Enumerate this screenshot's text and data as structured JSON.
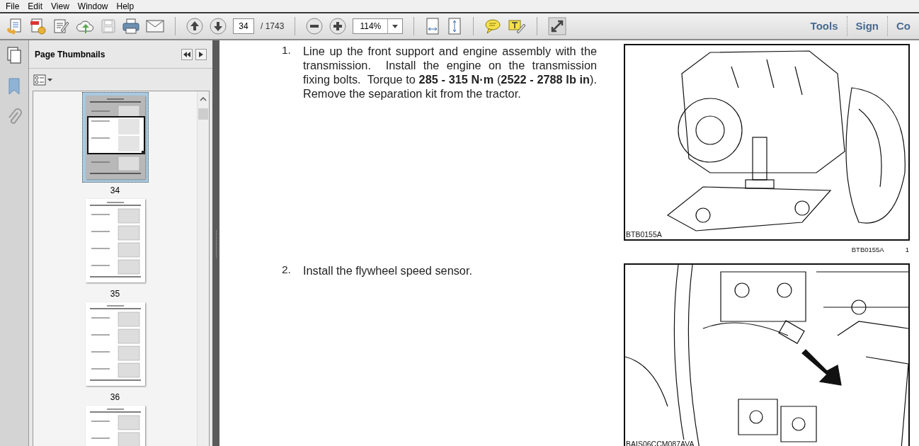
{
  "menu": [
    "File",
    "Edit",
    "View",
    "Window",
    "Help"
  ],
  "toolbar": {
    "page_number": "34",
    "page_count": "/ 1743",
    "zoom": "114%",
    "links": [
      "Tools",
      "Sign",
      "Co"
    ]
  },
  "side_panel": {
    "title": "Page Thumbnails",
    "thumbnails": [
      {
        "label": "34",
        "selected": true
      },
      {
        "label": "35",
        "selected": false
      },
      {
        "label": "36",
        "selected": false
      },
      {
        "selected": false
      }
    ]
  },
  "document": {
    "steps": [
      {
        "number": "1.",
        "text": "Line up the front support and engine assembly with the transmission.  Install the engine on the transmission fixing bolts.  Torque to **285 - 315 N·m** (**2522 - 2788 lb in**).  Remove the separation kit from the tractor.",
        "figure": {
          "kind": "engine",
          "label": "BTB0155A",
          "caption": "BTB0155A",
          "caption_number": "1"
        }
      },
      {
        "number": "2.",
        "text": "Install the flywheel speed sensor.",
        "figure": {
          "kind": "sensor",
          "label": "BAIS06CCM087AVA"
        }
      }
    ]
  }
}
